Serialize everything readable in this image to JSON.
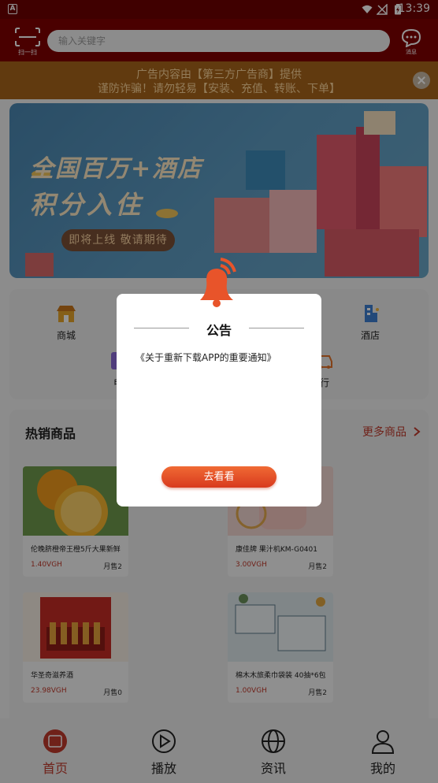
{
  "status_bar": {
    "time": "13:39",
    "app_badge": "A"
  },
  "header": {
    "scan_label": "扫一扫",
    "search_placeholder": "输入关键字",
    "message_label": "消息"
  },
  "ad_notice": {
    "line1": "广告内容由【第三方广告商】提供",
    "line2": "谨防诈骗！请勿轻易【安装、充值、转账、下单】"
  },
  "banner": {
    "headline1": "全国百万+酒店",
    "headline2": "积分入住",
    "button": "即将上线 敬请期待"
  },
  "categories": {
    "row1": [
      {
        "label": "商城",
        "icon": "shop-icon"
      },
      {
        "label": "酒店",
        "icon": "hotel-icon"
      }
    ],
    "row2": [
      {
        "label": "电",
        "icon": "electric-icon"
      },
      {
        "label": "行",
        "icon": "car-icon"
      }
    ]
  },
  "hot": {
    "title": "热销商品",
    "more": "更多商品",
    "products": [
      {
        "name": "伦晚脐橙帝王橙5斤大果新鲜",
        "price": "1.40VGH",
        "sold": "月售2"
      },
      {
        "name": "康佳牌 果汁机KM-G0401",
        "price": "3.00VGH",
        "sold": "月售2"
      },
      {
        "name": "华圣奇滋养酒",
        "price": "23.98VGH",
        "sold": "月售0"
      },
      {
        "name": "棉木木旅柔巾袋装 40抽*6包",
        "price": "1.00VGH",
        "sold": "月售2"
      }
    ]
  },
  "bottom_nav": [
    {
      "label": "首页",
      "icon": "home-icon",
      "active": true
    },
    {
      "label": "播放",
      "icon": "play-icon",
      "active": false
    },
    {
      "label": "资讯",
      "icon": "globe-icon",
      "active": false
    },
    {
      "label": "我的",
      "icon": "profile-icon",
      "active": false
    }
  ],
  "modal": {
    "title": "公告",
    "notice": "《关于重新下载APP的重要通知》",
    "button": "去看看"
  },
  "colors": {
    "header": "#800000",
    "accent": "#c0392b",
    "button_gradient_start": "#f06a34",
    "button_gradient_end": "#d83a1e"
  }
}
